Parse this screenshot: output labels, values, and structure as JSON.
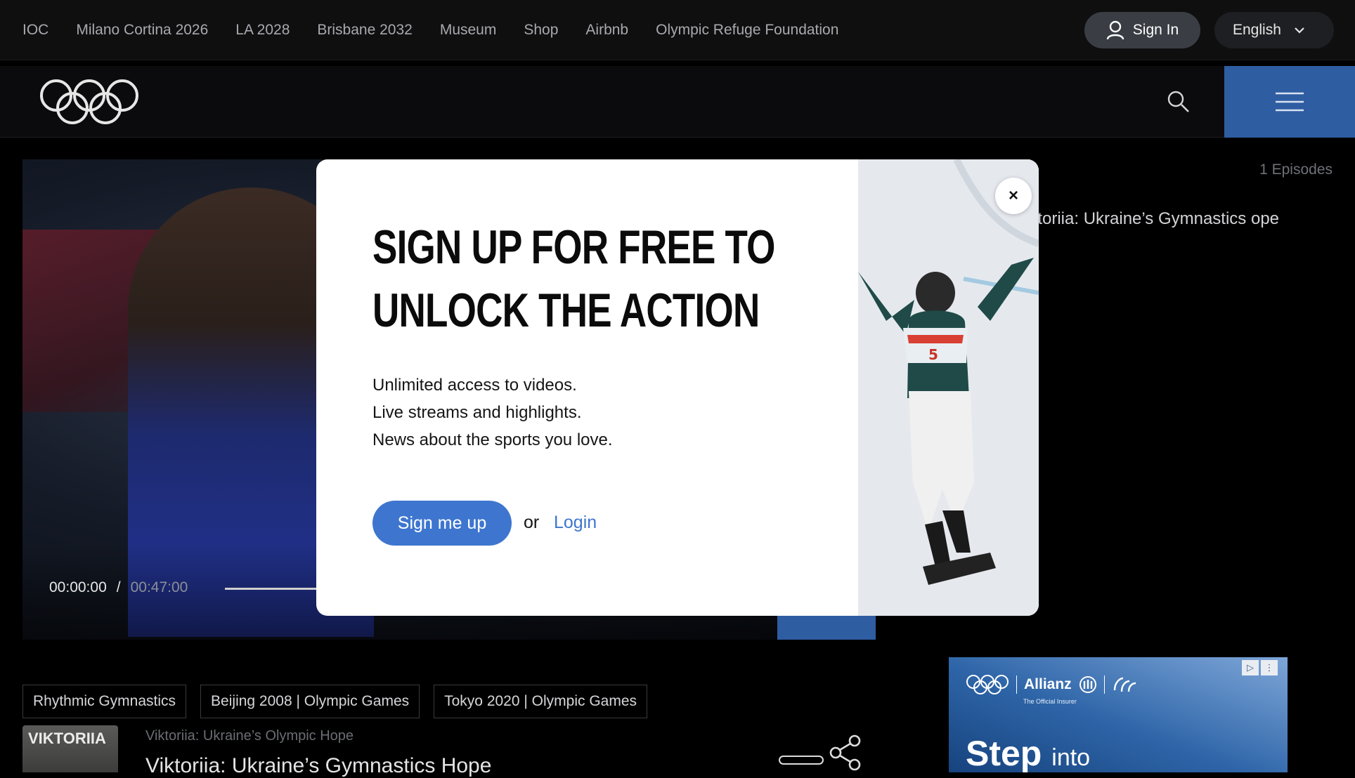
{
  "topbar": {
    "links": [
      "IOC",
      "Milano Cortina 2026",
      "LA 2028",
      "Brisbane 2032",
      "Museum",
      "Shop",
      "Airbnb",
      "Olympic Refuge Foundation"
    ],
    "sign_in": "Sign In",
    "language": "English"
  },
  "header": {
    "logo": "olympic-rings-icon",
    "search_icon": "search-icon",
    "menu_icon": "hamburger-menu-icon"
  },
  "player": {
    "current_time": "00:00:00",
    "separator": "/",
    "duration": "00:47:00"
  },
  "sidebar": {
    "episodes_count": "1 Episodes",
    "episode_title": "iktoriia: Ukraine’s Gymnastics ope"
  },
  "tags": [
    "Rhythmic Gymnastics",
    "Beijing 2008 | Olympic Games",
    "Tokyo 2020 | Olympic Games"
  ],
  "show": {
    "thumb_text": "VIKTORIIA",
    "label": "Viktoriia: Ukraine’s Olympic Hope",
    "title": "Viktoriia: Ukraine’s Gymnastics Hope"
  },
  "ad": {
    "brand": "Allianz",
    "sub": "The Official Insurer",
    "headline_big": "Step",
    "headline_small": "into"
  },
  "modal": {
    "headline_line1": "SIGN UP FOR FREE TO",
    "headline_line2": "UNLOCK THE ACTION",
    "body_line1": "Unlimited access to videos.",
    "body_line2": "Live streams and highlights.",
    "body_line3": "News about the sports you love.",
    "signup_label": "Sign me up",
    "or_label": "or",
    "login_label": "Login",
    "close_label": "×"
  },
  "colors": {
    "accent_blue": "#3e76cf",
    "menu_blue": "#2f5da2"
  }
}
